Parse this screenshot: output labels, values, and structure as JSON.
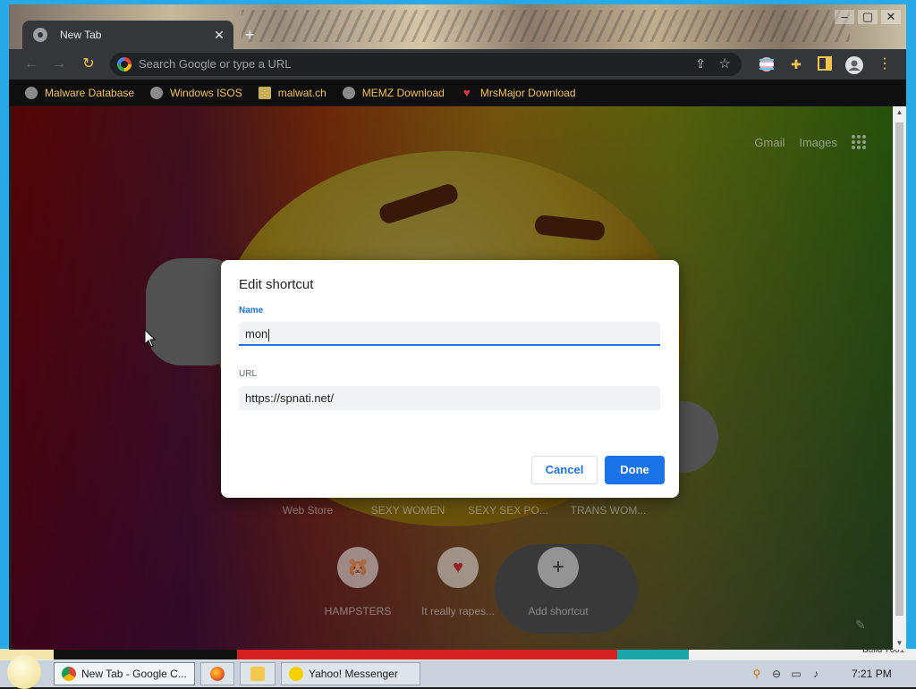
{
  "browser": {
    "tab_title": "New Tab",
    "tab_close": "✕",
    "new_tab": "+",
    "window_controls": {
      "minimize": "–",
      "maximize": "▢",
      "close": "✕"
    },
    "nav": {
      "back": "←",
      "forward": "→",
      "reload": "↻"
    },
    "omnibox_placeholder": "Search Google or type a URL",
    "toolbar_icons": [
      "share-icon",
      "star-icon",
      "flag-extension-icon",
      "puzzle-icon",
      "side-panel-icon",
      "profile-icon",
      "menu-icon"
    ]
  },
  "bookmarks": [
    {
      "label": "Malware Database",
      "icon": "globe-icon"
    },
    {
      "label": "Windows ISOS",
      "icon": "globe-icon"
    },
    {
      "label": "malwat.ch",
      "icon": "trophy-icon"
    },
    {
      "label": "MEMZ Download",
      "icon": "globe-icon"
    },
    {
      "label": "MrsMajor Download",
      "icon": "heart-icon"
    }
  ],
  "ntp": {
    "gmail": "Gmail",
    "images": "Images",
    "tiles_row1": [
      "Web Store",
      "SEXY WOMEN",
      "SEXY SEX PO...",
      "TRANS WOM..."
    ],
    "tiles_row2": [
      {
        "label": "HAMPSTERS",
        "icon": "🐹"
      },
      {
        "label": "It really rapes...",
        "icon": "♥"
      },
      {
        "label": "Add shortcut",
        "icon": "+"
      }
    ]
  },
  "dialog": {
    "title": "Edit shortcut",
    "name_label": "Name",
    "name_value": "mon",
    "url_label": "URL",
    "url_value": "https://spnati.net/",
    "cancel": "Cancel",
    "done": "Done"
  },
  "taskbar": {
    "tasks": [
      {
        "label": "New Tab - Google C...",
        "active": true
      },
      {
        "label": "",
        "icon": "firefox-icon"
      },
      {
        "label": "",
        "icon": "folder-icon"
      },
      {
        "label": "Yahoo! Messenger",
        "active": false
      }
    ],
    "clock": "7:21 PM",
    "build": "Build 7601"
  },
  "colors": {
    "accent": "#1a73e8",
    "bookmark_text": "#f3c44a"
  }
}
